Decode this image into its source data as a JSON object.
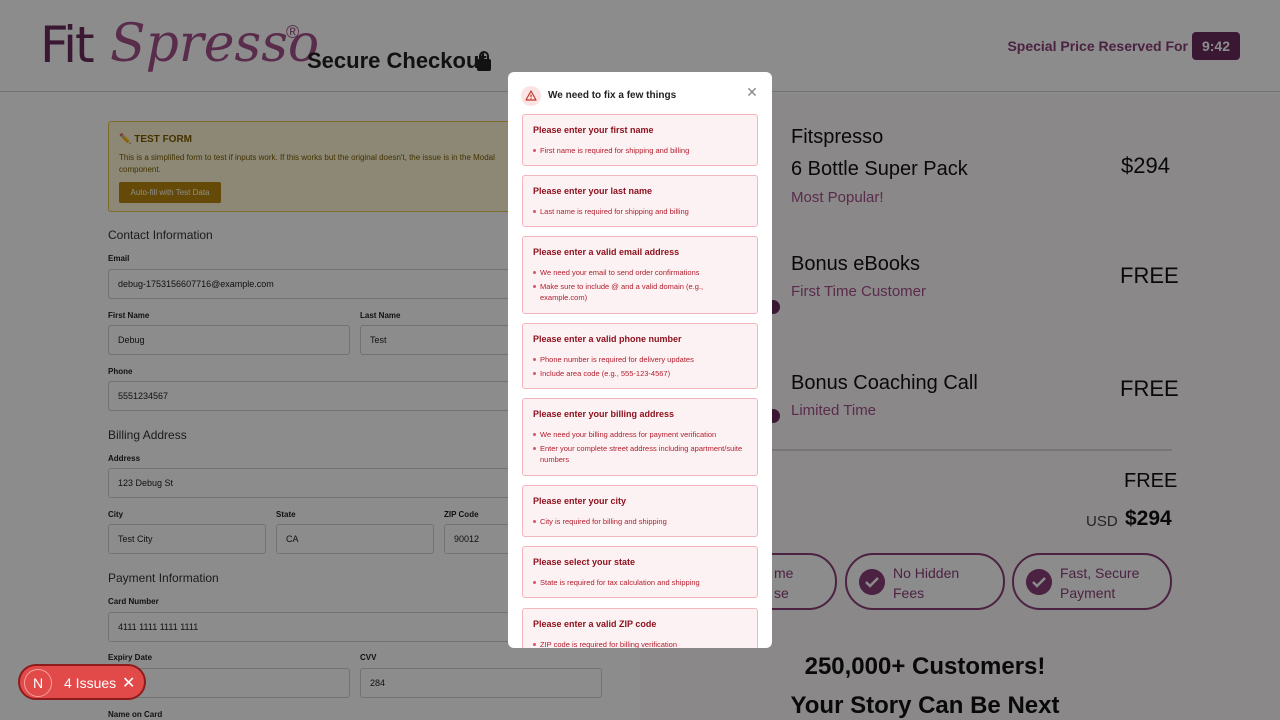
{
  "header": {
    "logo_part1": "Fit",
    "logo_part2": "Spresso",
    "logo_reg": "®",
    "secure_label": "Secure Checkout",
    "special_label": "Special Price Reserved For",
    "timer": "9:42"
  },
  "test_form": {
    "title": "✏️ TEST FORM",
    "description": "This is a simplified form to test if inputs work. If this works but the original doesn't, the issue is in the Modal component.",
    "autofill_label": "Auto-fill with Test Data"
  },
  "contact": {
    "title": "Contact Information",
    "email_label": "Email",
    "email_value": "debug-1753156607716@example.com",
    "first_label": "First Name",
    "first_value": "Debug",
    "last_label": "Last Name",
    "last_value": "Test",
    "phone_label": "Phone",
    "phone_value": "5551234567"
  },
  "billing": {
    "title": "Billing Address",
    "address_label": "Address",
    "address_value": "123 Debug St",
    "city_label": "City",
    "city_value": "Test City",
    "state_label": "State",
    "state_value": "CA",
    "zip_label": "ZIP Code",
    "zip_value": "90012"
  },
  "payment": {
    "title": "Payment Information",
    "card_label": "Card Number",
    "card_value": "4111 1111 1111 1111",
    "expiry_label": "Expiry Date",
    "cvv_label": "CVV",
    "cvv_value": "284",
    "name_label": "Name on Card"
  },
  "summary": {
    "product_brand": "Fitspresso",
    "product_name": "6 Bottle Super Pack",
    "product_tag": "Most Popular!",
    "product_price": "$294",
    "bonus1_name": "Bonus eBooks",
    "bonus1_tag": "First Time Customer",
    "bonus1_price": "FREE",
    "bonus2_name": "Bonus Coaching Call",
    "bonus2_tag": "Limited Time",
    "bonus2_price": "FREE",
    "shipping_value": "FREE",
    "currency": "USD",
    "total": "$294",
    "pill1_line1": "me",
    "pill1_line2": "se",
    "pill2_line1": "No Hidden",
    "pill2_line2": "Fees",
    "pill3_line1": "Fast, Secure",
    "pill3_line2": "Payment",
    "customers_line": "250,000+ Customers!",
    "story_line": "Your Story Can Be Next"
  },
  "modal": {
    "title": "We need to fix a few things",
    "errors": [
      {
        "title": "Please enter your first name",
        "items": [
          "First name is required for shipping and billing"
        ]
      },
      {
        "title": "Please enter your last name",
        "items": [
          "Last name is required for shipping and billing"
        ]
      },
      {
        "title": "Please enter a valid email address",
        "items": [
          "We need your email to send order confirmations",
          "Make sure to include @ and a valid domain (e.g., example.com)"
        ]
      },
      {
        "title": "Please enter a valid phone number",
        "items": [
          "Phone number is required for delivery updates",
          "Include area code (e.g., 555-123-4567)"
        ]
      },
      {
        "title": "Please enter your billing address",
        "items": [
          "We need your billing address for payment verification",
          "Enter your complete street address including apartment/suite numbers"
        ]
      },
      {
        "title": "Please enter your city",
        "items": [
          "City is required for billing and shipping"
        ]
      },
      {
        "title": "Please select your state",
        "items": [
          "State is required for tax calculation and shipping"
        ]
      },
      {
        "title": "Please enter a valid ZIP code",
        "items": [
          "ZIP code is required for billing verification"
        ]
      }
    ]
  },
  "issues_badge": {
    "initial": "N",
    "label": "4 Issues"
  },
  "colors": {
    "brand": "#6b2a5e",
    "brand_light": "#a4508a",
    "error_text": "#8b0f1c",
    "error_bg": "#fdf2f3",
    "issues_bg": "#e24a4a"
  }
}
